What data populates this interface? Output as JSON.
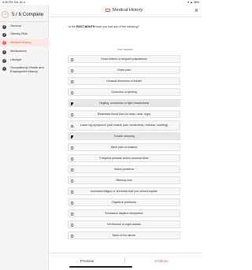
{
  "status_bar": {
    "time": "4:30 PM  Tue Jul 4",
    "right": "● ▲ 38%"
  },
  "sidebar": {
    "progress_label": "5 / 6 Complete",
    "items": [
      {
        "label": "General",
        "state": "done"
      },
      {
        "label": "Obesity Risk",
        "state": "done"
      },
      {
        "label": "Medical History",
        "state": "active"
      },
      {
        "label": "Medications",
        "state": "done"
      },
      {
        "label": "Lifestyle",
        "state": "done"
      },
      {
        "label": "Occupational Health and Employment History",
        "state": "done"
      }
    ]
  },
  "header": {
    "title": "Medical History",
    "close_icon": "×"
  },
  "question": {
    "prefix": "In the ",
    "emphasis": "PAST MONTH",
    "suffix": " have you had any of the following?"
  },
  "answer_label": "Your answer:",
  "options": [
    {
      "label": "Heart flutters or frequent palpitations",
      "checked": false
    },
    {
      "label": "Chest pain",
      "checked": false
    },
    {
      "label": "Unusual shortness of breath",
      "checked": false
    },
    {
      "label": "Dizziness or fainting",
      "checked": false
    },
    {
      "label": "Tingling, numbness or light-headedness",
      "checked": true
    },
    {
      "label": "Restricted blood flow (to head, neck, legs)",
      "checked": false
    },
    {
      "label": "Lower leg symptoms (calf muscle pain, tenderness, redness, swelling)",
      "checked": false
    },
    {
      "label": "Trouble sleeping",
      "checked": true
    },
    {
      "label": "Back pain or sciatica",
      "checked": false
    },
    {
      "label": "Frequent prostate and/or unusual thirst",
      "checked": false
    },
    {
      "label": "Vision problems",
      "checked": false
    },
    {
      "label": "Memory loss",
      "checked": false
    },
    {
      "label": "Increased fatigue or tiredness that you cannot explain",
      "checked": false
    },
    {
      "label": "Digestive problems",
      "checked": false
    },
    {
      "label": "Excessive daytime sleepiness",
      "checked": false
    },
    {
      "label": "Hot flushes or night sweats",
      "checked": false
    },
    {
      "label": "None of the above",
      "checked": false
    }
  ],
  "footer": {
    "previous": "Previous",
    "continue": "Continue"
  },
  "colors": {
    "accent": "#e05a4f",
    "sidebar_bg": "#f7f5f3",
    "active_bg": "#fde8e6"
  }
}
